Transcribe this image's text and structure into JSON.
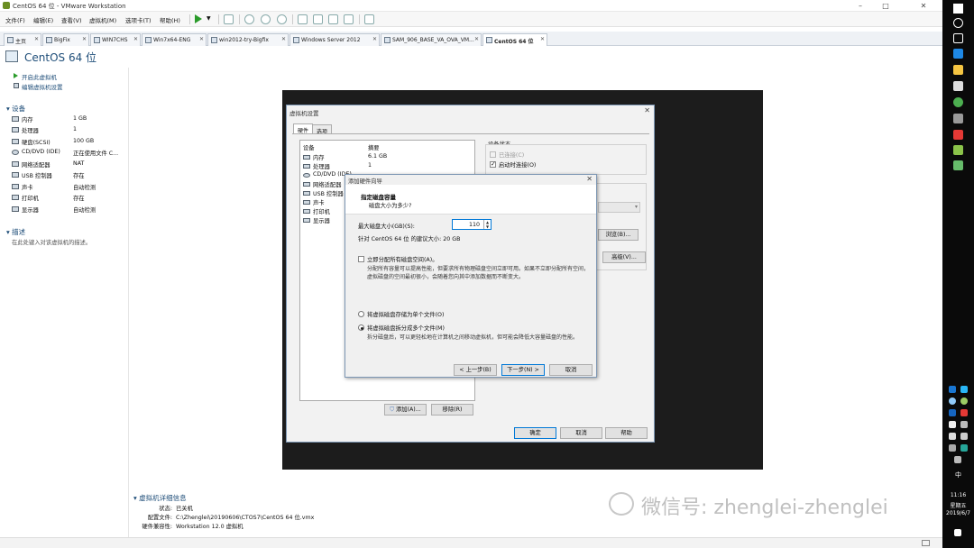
{
  "window": {
    "title": "CentOS 64 位 - VMware Workstation"
  },
  "menu": [
    "文件(F)",
    "编辑(E)",
    "查看(V)",
    "虚拟机(M)",
    "选项卡(T)",
    "帮助(H)"
  ],
  "tabs": [
    {
      "label": "主页"
    },
    {
      "label": "BigFix"
    },
    {
      "label": "WIN7CHS"
    },
    {
      "label": "Win7x64-ENG"
    },
    {
      "label": "win2012-try-Bigfix"
    },
    {
      "label": "Windows Server 2012"
    },
    {
      "label": "SAM_906_BASE_VA_OVA_VM..."
    },
    {
      "label": "CentOS 64 位"
    }
  ],
  "vm": {
    "title": "CentOS 64 位"
  },
  "left": {
    "actions": [
      "开启此虚拟机",
      "编辑虚拟机设置"
    ],
    "devices_heading": "设备",
    "devices": [
      {
        "name": "内存",
        "value": "1 GB"
      },
      {
        "name": "处理器",
        "value": "1"
      },
      {
        "name": "硬盘(SCSI)",
        "value": "100 GB"
      },
      {
        "name": "CD/DVD (IDE)",
        "value": "正在使用文件 C..."
      },
      {
        "name": "网络适配器",
        "value": "NAT"
      },
      {
        "name": "USB 控制器",
        "value": "存在"
      },
      {
        "name": "声卡",
        "value": "自动检测"
      },
      {
        "name": "打印机",
        "value": "存在"
      },
      {
        "name": "显示器",
        "value": "自动检测"
      }
    ],
    "desc_heading": "描述",
    "desc_placeholder": "在此处键入对该虚拟机的描述。"
  },
  "settings": {
    "title": "虚拟机设置",
    "tabs": [
      "硬件",
      "选项"
    ],
    "col_device": "设备",
    "col_summary": "摘要",
    "hardware": [
      {
        "name": "内存",
        "value": "6.1 GB"
      },
      {
        "name": "处理器",
        "value": "1"
      },
      {
        "name": "CD/DVD (IDE)",
        "value": ""
      },
      {
        "name": "网络适配器",
        "value": ""
      },
      {
        "name": "USB 控制器",
        "value": ""
      },
      {
        "name": "声卡",
        "value": ""
      },
      {
        "name": "打印机",
        "value": ""
      },
      {
        "name": "显示器",
        "value": ""
      }
    ],
    "device_status": "设备状态",
    "connected": "已连接(C)",
    "connect_on_power": "启动时连接(O)",
    "browse": "浏览(B)...",
    "advanced": "高级(V)...",
    "add": "添加(A)...",
    "remove": "移除(R)",
    "ok": "确定",
    "cancel": "取消",
    "help": "帮助"
  },
  "wizard": {
    "title": "添加硬件向导",
    "heading": "指定磁盘容量",
    "subheading": "磁盘大小为多少?",
    "max_size_label": "最大磁盘大小(GB)(S):",
    "max_size_value": "110",
    "recommend": "针对 CentOS 64 位 的建议大小: 20 GB",
    "allocate_label": "立即分配所有磁盘空间(A)。",
    "allocate_desc": "分配所有容量可以提高性能，但要求所有物理磁盘空间立即可用。如果不立即分配所有空间，虚拟磁盘的空间最初很小，会随着您向其中添加数据而不断变大。",
    "single_file": "将虚拟磁盘存储为单个文件(O)",
    "multi_file": "将虚拟磁盘拆分成多个文件(M)",
    "multi_desc": "拆分磁盘后，可以更轻松地在计算机之间移动虚拟机，但可能会降低大容量磁盘的性能。",
    "back": "< 上一步(B)",
    "next": "下一步(N) >",
    "cancel": "取消"
  },
  "details": {
    "heading": "虚拟机详细信息",
    "rows": [
      {
        "key": "状态:",
        "value": "已关机"
      },
      {
        "key": "配置文件:",
        "value": "C:\\Zhenglei\\20190606\\CTOS7\\CentOS 64 位.vmx"
      },
      {
        "key": "硬件兼容性:",
        "value": "Workstation 12.0 虚拟机"
      }
    ]
  },
  "watermark": "微信号: zhenglei-zhenglei",
  "clock": {
    "time": "11:16",
    "weekday": "星期五",
    "date": "2019/6/7"
  },
  "tray_lang": "中"
}
